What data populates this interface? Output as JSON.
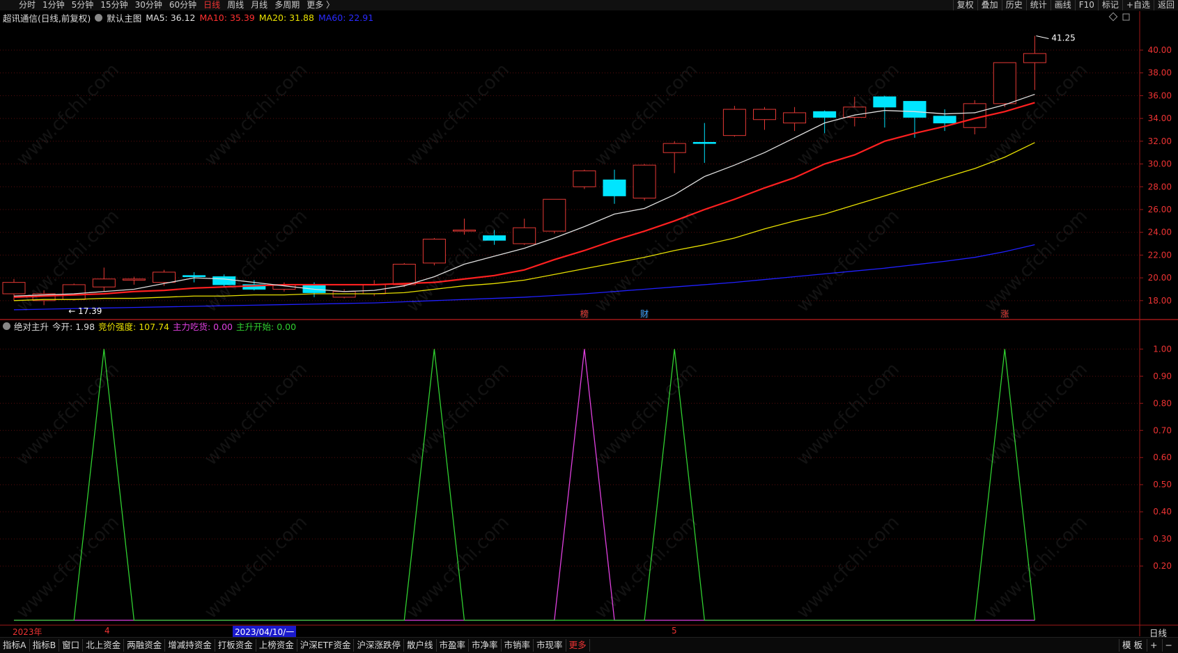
{
  "toolbar": {
    "tabs": [
      "分时",
      "1分钟",
      "5分钟",
      "15分钟",
      "30分钟",
      "60分钟",
      "日线",
      "周线",
      "月线",
      "多周期",
      "更多 〉"
    ],
    "active_tab": "日线",
    "right_buttons": [
      "复权",
      "叠加",
      "历史",
      "统计",
      "画线",
      "F10",
      "标记",
      "+自选",
      "返回"
    ]
  },
  "main_chart": {
    "title": "超讯通信(日线,前复权)",
    "template_name": "默认主图",
    "ma5_label": "MA5: 36.12",
    "ma10_label": "MA10: 35.39",
    "ma20_label": "MA20: 31.88",
    "ma60_label": "MA60: 22.91",
    "high_label": "41.25",
    "low_label": "← 17.39",
    "markers": [
      "榜",
      "财",
      "涨"
    ]
  },
  "indicator": {
    "name": "绝对主升",
    "today_open_label": "今开: 1.98",
    "bid_strength_label": "竞价强度: 107.74",
    "main_force_label": "主力吃货: 0.00",
    "rise_start_label": "主升开始: 0.00"
  },
  "dates": {
    "year": "2023年",
    "month_4": "4",
    "cursor_date": "2023/04/10/一",
    "month_5": "5",
    "period": "日线"
  },
  "bottom": {
    "buttons": [
      "指标A",
      "指标B",
      "窗口",
      "北上资金",
      "两融资金",
      "增减持资金",
      "打板资金",
      "上榜资金",
      "沪深ETF资金",
      "沪深涨跌停",
      "散户线",
      "市盈率",
      "市净率",
      "市销率",
      "市现率"
    ],
    "more": "更多",
    "right_buttons": [
      "模 板",
      "+",
      "−"
    ]
  },
  "watermark": "www.cfchi.com",
  "colors": {
    "up": "#e53935",
    "down": "#00e5ff",
    "ma5": "#e0e0e0",
    "ma10": "#ff2020",
    "ma20": "#e8e000",
    "ma60": "#2020ff",
    "ind_green": "#30d030",
    "ind_magenta": "#e040e0"
  },
  "chart_data": [
    {
      "type": "candlestick",
      "title": "",
      "y_ticks": [
        18.0,
        20.0,
        22.0,
        24.0,
        26.0,
        28.0,
        30.0,
        32.0,
        34.0,
        36.0,
        38.0,
        40.0
      ],
      "ylim": [
        16.4,
        42.2
      ],
      "candles": [
        [
          18.6,
          19.6,
          18.0,
          19.9
        ],
        [
          18.0,
          18.6,
          17.6,
          18.9
        ],
        [
          18.1,
          19.4,
          18.0,
          19.5
        ],
        [
          19.2,
          19.9,
          18.8,
          20.9
        ],
        [
          19.8,
          19.9,
          19.4,
          20.1
        ],
        [
          19.6,
          20.5,
          19.3,
          20.7
        ],
        [
          20.2,
          20.1,
          19.6,
          20.5
        ],
        [
          20.1,
          19.4,
          19.2,
          20.3
        ],
        [
          19.4,
          19.0,
          18.9,
          19.8
        ],
        [
          19.0,
          19.4,
          18.8,
          19.6
        ],
        [
          19.4,
          18.7,
          18.3,
          19.6
        ],
        [
          18.3,
          18.8,
          18.2,
          19.0
        ],
        [
          18.6,
          19.4,
          18.4,
          19.8
        ],
        [
          19.4,
          21.2,
          19.2,
          21.3
        ],
        [
          21.3,
          23.4,
          21.1,
          23.5
        ],
        [
          24.1,
          24.2,
          23.8,
          25.2
        ],
        [
          23.7,
          23.3,
          22.9,
          24.2
        ],
        [
          23.0,
          24.4,
          22.9,
          25.2
        ],
        [
          24.1,
          26.9,
          23.9,
          26.9
        ],
        [
          28.0,
          29.4,
          27.8,
          29.5
        ],
        [
          28.6,
          27.2,
          26.5,
          29.5
        ],
        [
          27.0,
          29.9,
          26.8,
          30.0
        ],
        [
          31.0,
          31.8,
          29.2,
          32.0
        ],
        [
          31.9,
          31.8,
          30.1,
          33.6
        ],
        [
          32.5,
          34.8,
          32.4,
          35.1
        ],
        [
          33.9,
          34.8,
          33.0,
          35.0
        ],
        [
          33.6,
          34.5,
          32.9,
          35.0
        ],
        [
          34.6,
          34.1,
          32.7,
          34.7
        ],
        [
          34.1,
          35.0,
          33.3,
          35.9
        ],
        [
          35.9,
          35.0,
          33.2,
          36.0
        ],
        [
          35.5,
          34.1,
          32.3,
          35.5
        ],
        [
          34.2,
          33.6,
          32.9,
          34.8
        ],
        [
          33.2,
          35.3,
          32.6,
          35.6
        ],
        [
          35.3,
          38.9,
          35.0,
          38.9
        ],
        [
          38.9,
          39.7,
          36.5,
          41.25
        ]
      ],
      "ma5": [
        18.4,
        18.5,
        18.6,
        18.8,
        19.0,
        19.5,
        20.0,
        19.9,
        19.6,
        19.3,
        19.0,
        18.8,
        18.9,
        19.3,
        20.1,
        21.2,
        21.9,
        22.6,
        23.5,
        24.5,
        25.6,
        26.1,
        27.3,
        28.9,
        29.9,
        31.0,
        32.3,
        33.6,
        34.3,
        34.7,
        34.6,
        34.4,
        34.5,
        35.2,
        36.12
      ],
      "ma10": [
        18.3,
        18.4,
        18.5,
        18.6,
        18.8,
        18.9,
        19.1,
        19.2,
        19.3,
        19.4,
        19.4,
        19.4,
        19.4,
        19.5,
        19.6,
        19.9,
        20.2,
        20.7,
        21.6,
        22.4,
        23.3,
        24.1,
        25.0,
        26.0,
        26.9,
        27.9,
        28.8,
        30.0,
        30.8,
        32.0,
        32.7,
        33.3,
        34.0,
        34.6,
        35.39
      ],
      "ma20": [
        18.0,
        18.1,
        18.1,
        18.2,
        18.2,
        18.3,
        18.4,
        18.4,
        18.5,
        18.5,
        18.6,
        18.6,
        18.6,
        18.7,
        19.0,
        19.3,
        19.5,
        19.8,
        20.3,
        20.8,
        21.3,
        21.8,
        22.4,
        22.9,
        23.5,
        24.3,
        25.0,
        25.6,
        26.4,
        27.2,
        28.0,
        28.8,
        29.6,
        30.6,
        31.88
      ],
      "ma60": [
        17.2,
        17.25,
        17.3,
        17.35,
        17.4,
        17.45,
        17.5,
        17.55,
        17.6,
        17.65,
        17.7,
        17.75,
        17.8,
        17.9,
        18.0,
        18.1,
        18.2,
        18.3,
        18.45,
        18.6,
        18.8,
        19.0,
        19.2,
        19.4,
        19.6,
        19.85,
        20.1,
        20.35,
        20.6,
        20.85,
        21.15,
        21.45,
        21.8,
        22.3,
        22.91
      ]
    },
    {
      "type": "line",
      "title": "绝对主升",
      "y_ticks": [
        0.2,
        0.3,
        0.4,
        0.5,
        0.6,
        0.7,
        0.8,
        0.9,
        1.0
      ],
      "ylim": [
        0,
        1.06
      ],
      "series": [
        {
          "name": "",
          "color": "green",
          "values": [
            0,
            0,
            0,
            1,
            0,
            0,
            0,
            0,
            0,
            0,
            0,
            0,
            0,
            0,
            1,
            0,
            0,
            0,
            0,
            0,
            0,
            0,
            1,
            0,
            0,
            0,
            0,
            0,
            0,
            0,
            0,
            0,
            0,
            1,
            0
          ]
        },
        {
          "name": "",
          "color": "magenta",
          "values": [
            0,
            0,
            0,
            0,
            0,
            0,
            0,
            0,
            0,
            0,
            0,
            0,
            0,
            0,
            0,
            0,
            0,
            0,
            0,
            1,
            0,
            0,
            0,
            0,
            0,
            0,
            0,
            0,
            0,
            0,
            0,
            0,
            0,
            0,
            0
          ]
        }
      ]
    }
  ]
}
